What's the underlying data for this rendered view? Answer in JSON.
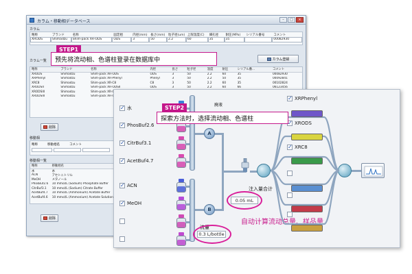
{
  "window1": {
    "title": "カラム・移動相データベース",
    "column_section": "カラム",
    "column_form_headers": [
      "略称",
      "ブランド",
      "名称",
      "固定相",
      "内径(mm)",
      "長さ(mm)",
      "粒子径(um)",
      "上限温度(C)",
      "細孔径",
      "耐圧(MPa)",
      "シリアル番号",
      "コメント"
    ],
    "column_form_values": [
      "XRODS",
      "Shimadzu",
      "Shim-pack XR-ODS",
      "ODS",
      "3",
      "50",
      "2.2",
      "60",
      "35",
      "35",
      "",
      "00082930"
    ],
    "column_list_label": "カラム一覧",
    "register_button": "カラム登録",
    "column_table_headers": [
      "略称",
      "ブランド",
      "名称",
      "内径",
      "長さ",
      "粒子径",
      "温度",
      "耐圧",
      "シリアル番...",
      "コメント"
    ],
    "column_rows": [
      [
        "XRODS",
        "Shimadzu",
        "Shim-pack XR-ODS",
        "ODS",
        "3",
        "50",
        "2.2",
        "60",
        "35",
        "00082930"
      ],
      [
        "XRPhenyl",
        "Shimadzu",
        "Shim-pack XR-Phenyl",
        "Phenyl",
        "3",
        "50",
        "2.2",
        "50",
        "35",
        "00092841"
      ],
      [
        "XRC8",
        "Shimadzu",
        "Shim-pack XR-C8",
        "C8",
        "3",
        "50",
        "2.2",
        "60",
        "35",
        "00102824"
      ],
      [
        "XRODSII",
        "Shimadzu",
        "Shim-pack XR-ODSII",
        "ODS",
        "3",
        "50",
        "2.2",
        "60",
        "66",
        "06123456"
      ],
      [
        "XRODSIII",
        "Shimadzu",
        "Shim-pack XR-ODSII",
        "ODS",
        "3",
        "50",
        "1.6",
        "60",
        "66",
        "06123456"
      ],
      [
        "XRODSIII",
        "Shimadzu",
        "Shim-pack XR-ODSIII",
        "ODS",
        "3",
        "50",
        "1.6",
        "60",
        "66",
        "06123456"
      ]
    ],
    "delete_button_1": "削除",
    "mobile_section": "移動相",
    "mobile_form_headers": [
      "略称",
      "移動相名",
      "コメント"
    ],
    "mobile_list_label": "移動相一覧",
    "mobile_table_headers": [
      "略称",
      "移動相名"
    ],
    "mobile_rows": [
      [
        "水",
        "水"
      ],
      [
        "ACN",
        "アセトニトリル"
      ],
      [
        "MeOH",
        "メタノール"
      ],
      [
        "PhosBuf2.6",
        "10 mmol/L (Sodium) Phosphate Buffer"
      ],
      [
        "CitrBuf3.1",
        "10 mmol/L (Sodium) Citrate Buffer"
      ],
      [
        "AcetBuf4.7",
        "10 mmol/L (Ammonium) Acetate Buffer"
      ],
      [
        "AcetBuf4.6",
        "10 mmol/L (Ammonium) Acetate Solution"
      ]
    ],
    "delete_button_2": "削除"
  },
  "step1": {
    "tag": "STEP1",
    "text": "预先将流动相、色谱柱登录在数据库中"
  },
  "step2": {
    "tag": "STEP2",
    "text": "探索方法时，选择流动相、色谱柱"
  },
  "solvents_a": [
    {
      "label": "水",
      "checked": true,
      "color": "#3b7fd8"
    },
    {
      "label": "PhosBuf2.6",
      "checked": true,
      "color": "#d94ab0"
    },
    {
      "label": "CitrBuf3.1",
      "checked": true,
      "color": "#d94ab0"
    },
    {
      "label": "AcetBuf4.7",
      "checked": true,
      "color": "#d94ab0"
    }
  ],
  "solvents_b": [
    {
      "label": "ACN",
      "checked": true,
      "color": "#4a5fd9"
    },
    {
      "label": "MeOH",
      "checked": true,
      "color": "#b64ad9"
    },
    {
      "label": "",
      "checked": false,
      "color": "#d04ab5"
    },
    {
      "label": "",
      "checked": false,
      "color": "#c04ad0"
    }
  ],
  "pumps": {
    "a": "A",
    "b": "B"
  },
  "mixer_label": "廃液",
  "injection_label": "注入量合计",
  "injection_value": "0.05  mL",
  "flow_label": "流量",
  "flow_value": "0.3 L/bottle",
  "auto_note": "自动计算流动总量、样品量",
  "columns": [
    {
      "label": "XRPhenyl",
      "checked": true,
      "color": "#6f57c9"
    },
    {
      "label": "XRODS",
      "checked": true,
      "color": "#d9d440"
    },
    {
      "label": "XRC8",
      "checked": true,
      "color": "#3a9a4a"
    },
    {
      "label": "",
      "checked": false,
      "color": "#5a8fd1"
    },
    {
      "label": "",
      "checked": false,
      "color": "#c33b4a"
    },
    {
      "label": "",
      "checked": false,
      "color": "#c9a040"
    }
  ]
}
